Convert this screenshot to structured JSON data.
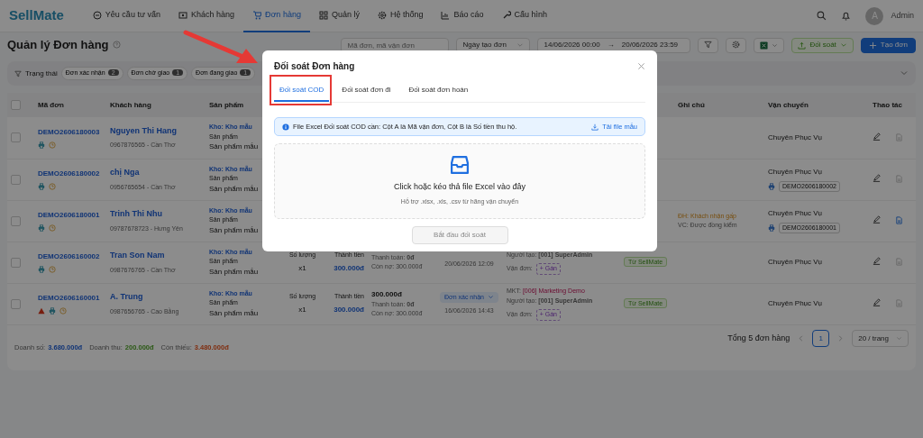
{
  "nav": {
    "logo": "SellMate",
    "items": [
      {
        "label": "Yêu cầu tư vấn",
        "selected": false
      },
      {
        "label": "Khách hàng",
        "selected": false
      },
      {
        "label": "Đơn hàng",
        "selected": true
      },
      {
        "label": "Quản lý",
        "selected": false
      },
      {
        "label": "Hệ thống",
        "selected": false
      },
      {
        "label": "Báo cáo",
        "selected": false
      },
      {
        "label": "Cấu hình",
        "selected": false
      }
    ],
    "avatar": "A",
    "user": "Admin"
  },
  "page_title": "Quản lý Đơn hàng",
  "toolbar": {
    "search_placeholder": "Mã đơn, mã vận đơn",
    "date_type": "Ngày tạo đơn",
    "date_from": "14/06/2026 00:00",
    "date_sep": "→",
    "date_to": "20/06/2026 23:59",
    "reconcile_button": "Đối soát",
    "create_button": "Tạo đơn"
  },
  "filters": {
    "label": "Trạng thái",
    "chips": [
      {
        "label": "Đơn xác nhận",
        "count": "2"
      },
      {
        "label": "Đơn chờ giao",
        "count": "1"
      },
      {
        "label": "Đơn đang giao",
        "count": "1"
      }
    ]
  },
  "table": {
    "select_all_checked": false,
    "columns": [
      "Mã đơn",
      "Khách hàng",
      "Sản phẩm",
      "Ghi chú",
      "Vận chuyển",
      "Thao tác"
    ],
    "rows": [
      {
        "checked": false,
        "code": "DEMO2606180003",
        "warning": false,
        "customer": "Nguyen Thi Hang",
        "contact": "0967876565 - Cần Thơ",
        "warehouse": "Kho: Kho mẫu",
        "product_label": "Sản phẩm",
        "product": "Sản phẩm mẫu",
        "shipping": "Chuyên Phục Vụ",
        "has_invoice": false
      },
      {
        "checked": false,
        "code": "DEMO2606180002",
        "warning": false,
        "customer": "chị Nga",
        "contact": "0956765654 - Cần Thơ",
        "warehouse": "Kho: Kho mẫu",
        "product_label": "Sản phẩm",
        "product": "Sản phẩm mẫu",
        "shipping": "Chuyên Phục Vụ",
        "tracking": "DEMO2606180002",
        "has_invoice": false
      },
      {
        "checked": false,
        "code": "DEMO2606180001",
        "warning": false,
        "customer": "Trinh Thi Nhu",
        "contact": "09787678723 - Hưng Yên",
        "warehouse": "Kho: Kho mẫu",
        "product_label": "Sản phẩm",
        "product": "Sản phẩm mẫu",
        "note_order": "ĐH: Khách nhận gấp",
        "note_ship": "VC: Được đồng kiểm",
        "shipping": "Chuyên Phục Vụ",
        "tracking": "DEMO2606180001",
        "has_invoice": true
      },
      {
        "checked": false,
        "code": "DEMO2606160002",
        "warning": false,
        "customer": "Tran Son Nam",
        "contact": "0987676765 - Cần Thơ",
        "warehouse": "Kho: Kho mẫu",
        "product_label": "Sản phẩm",
        "product": "Sản phẩm mẫu",
        "qty_label": "Số lượng",
        "qty": "x1",
        "total_label": "Thành tiền",
        "total": "300.000đ",
        "paid": "Thanh toán: **0đ**",
        "debt": "Còn nợ: 300.000đ",
        "date": "20/06/2026 12:09",
        "creator": "Người tạo: **[001] SuperAdmin**",
        "waybill": "Vận đơn:",
        "assign": "+ Gán",
        "source": "Từ SellMate",
        "shipping": "Chuyên Phục Vụ",
        "has_invoice": false
      },
      {
        "checked": false,
        "code": "DEMO2606160001",
        "warning": true,
        "customer": "A. Trung",
        "contact": "0987656765 - Cao Bằng",
        "warehouse": "Kho: Kho mẫu",
        "product_label": "Sản phẩm",
        "product": "Sản phẩm mẫu",
        "qty_label": "Số lượng",
        "qty": "x1",
        "total_label": "Thành tiền",
        "total": "300.000đ",
        "amount": "300.000đ",
        "paid": "Thanh toán: **0đ**",
        "debt": "Còn nợ: 300.000đ",
        "status": "Đơn xác nhận",
        "date": "16/06/2026 14:43",
        "mkt_label": "MKT:",
        "mkt": "[006] Marketing Demo",
        "creator": "Người tạo: **[001] SuperAdmin**",
        "waybill": "Vận đơn:",
        "assign": "+ Gán",
        "source": "Từ SellMate",
        "shipping": "Chuyên Phục Vụ",
        "has_invoice": false
      }
    ]
  },
  "summary": [
    {
      "label": "Doanh số:",
      "value": "3.680.000đ"
    },
    {
      "label": "Doanh thu:",
      "value": "200.000đ"
    },
    {
      "label": "Còn thiếu:",
      "value": "3.480.000đ"
    }
  ],
  "pagination": {
    "total": "Tổng 5 đơn hàng",
    "pages": [
      {
        "label": "1",
        "selected": true
      }
    ],
    "page_size": "20 / trang"
  },
  "modal": {
    "title": "Đối soát Đơn hàng",
    "tabs": [
      {
        "label": "Đối soát COD",
        "selected": true
      },
      {
        "label": "Đối soát đơn đi",
        "selected": false
      },
      {
        "label": "Đối soát đơn hoàn",
        "selected": false
      }
    ],
    "info": "File Excel Đối soát COD cần: Cột A là Mã vận đơn, Cột B là Số tiền thu hộ.",
    "template_link": "Tải file mẫu",
    "drop_title": "Click hoặc kéo thả file Excel vào đây",
    "drop_hint": "Hỗ trợ .xlsx, .xls, .csv từ hãng vận chuyển",
    "start_button": "Bắt đầu đối soát",
    "start_disabled": true
  }
}
